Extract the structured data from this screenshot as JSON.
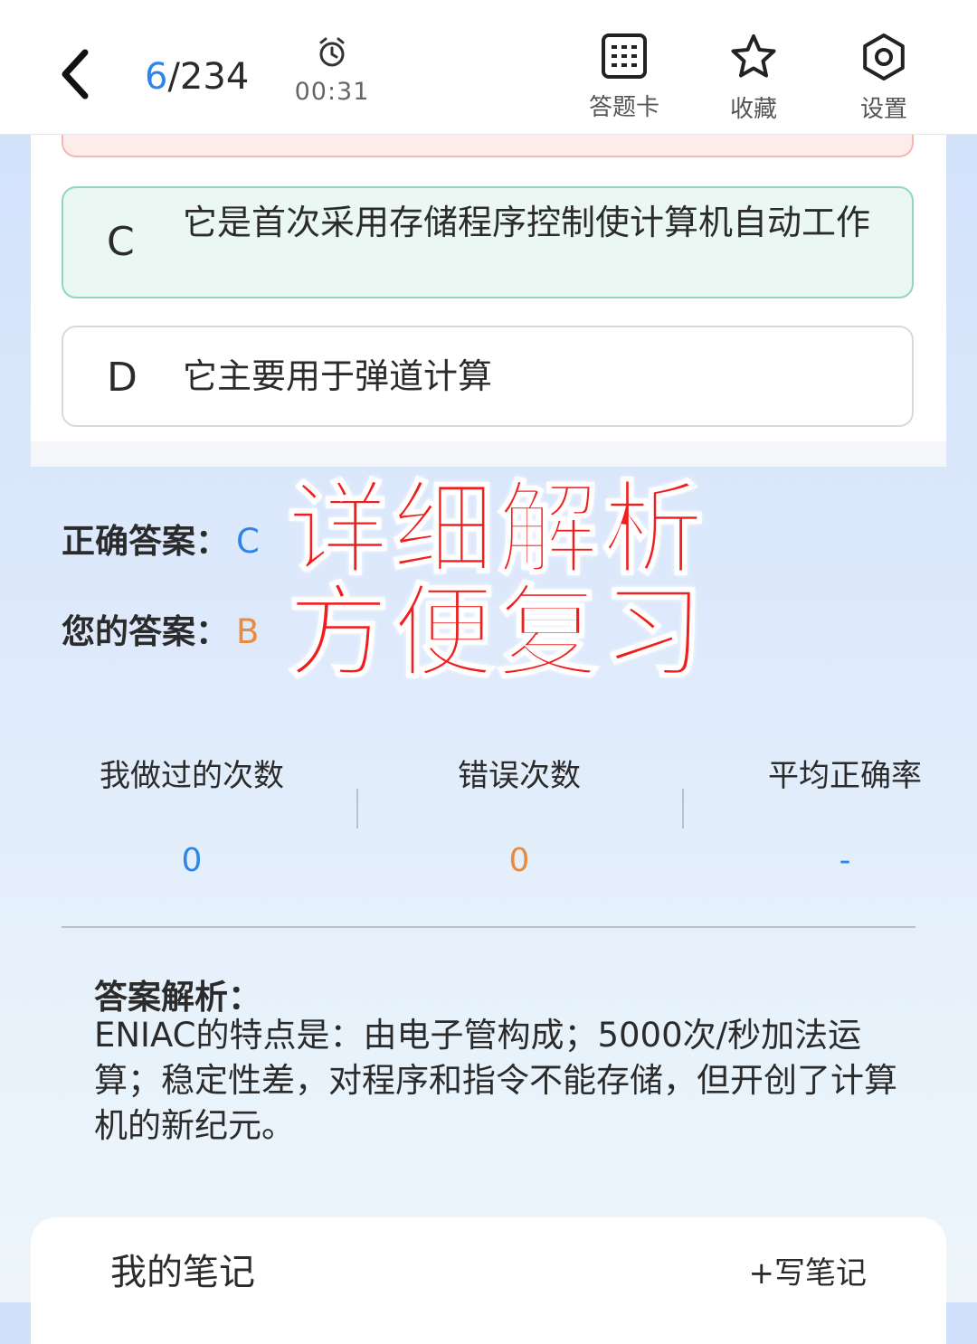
{
  "header": {
    "progress_current": "6",
    "progress_total": "/234",
    "timer": "00:31",
    "tools": [
      {
        "label": "答题卡",
        "icon": "answer-card-icon"
      },
      {
        "label": "收藏",
        "icon": "star-icon"
      },
      {
        "label": "设置",
        "icon": "gear-icon"
      }
    ]
  },
  "options": [
    {
      "letter": "C",
      "text": "它是首次采用存储程序控制使计算机自动工作",
      "state": "correct"
    },
    {
      "letter": "D",
      "text": "它主要用于弹道计算",
      "state": "normal"
    }
  ],
  "answers": {
    "correct_label": "正确答案：",
    "correct_value": "C",
    "yours_label": "您的答案：",
    "yours_value": "B"
  },
  "promo": {
    "line1": "详细解析",
    "line2": "方便复习"
  },
  "stats": [
    {
      "label": "我做过的次数",
      "value": "0",
      "color": "#2f86e8"
    },
    {
      "label": "错误次数",
      "value": "0",
      "color": "#e98b3a"
    },
    {
      "label": "平均正确率",
      "value": "-",
      "color": "#2f86e8"
    }
  ],
  "analysis": {
    "title": "答案解析：",
    "body": "ENIAC的特点是：由电子管构成；5000次/秒加法运算；稳定性差，对程序和指令不能存储，但开创了计算机的新纪元。"
  },
  "notes": {
    "title": "我的笔记",
    "write_label": "+写笔记"
  },
  "colors": {
    "accent_blue": "#2f86e8",
    "accent_orange": "#e98b3a",
    "promo_red": "#f01e1e",
    "correct_green_border": "#8fd7c2",
    "wrong_red_border": "#f2b8b2"
  }
}
